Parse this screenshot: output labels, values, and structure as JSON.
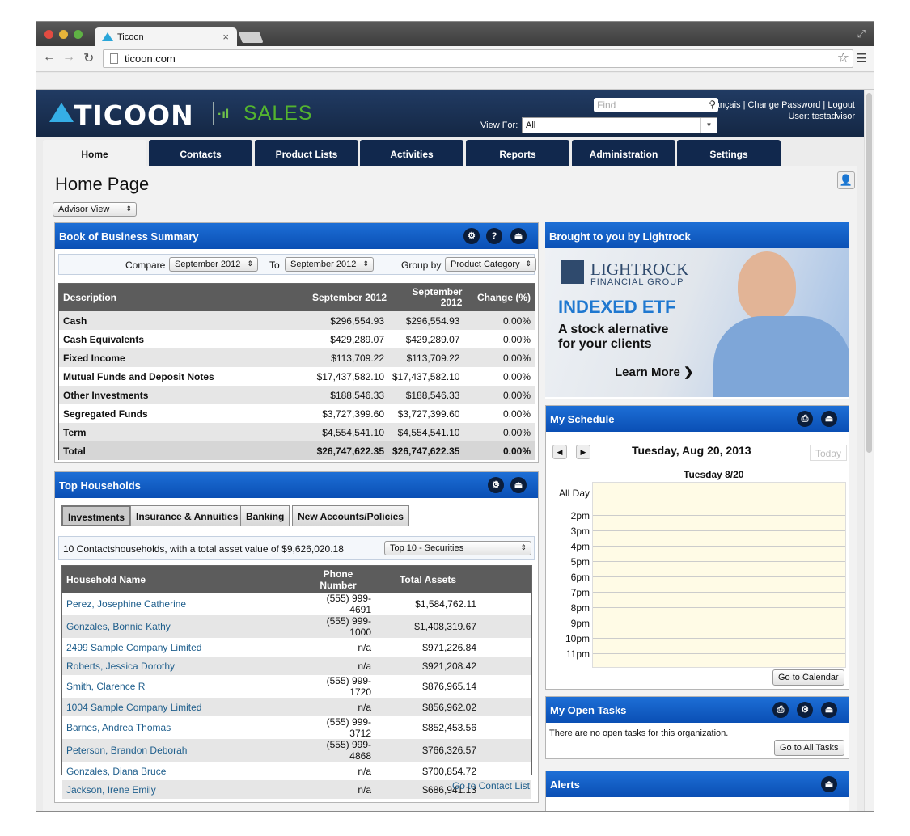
{
  "browser": {
    "tab_title": "Ticoon",
    "url": "ticoon.com"
  },
  "header": {
    "logo_name": "TICOON",
    "logo_sales": "SALES",
    "find_placeholder": "Find",
    "view_for_label": "View For:",
    "view_for_value": "All",
    "links": "Français | Change Password | Logout",
    "user": "User: testadvisor"
  },
  "tabs": [
    {
      "label": "Home"
    },
    {
      "label": "Contacts"
    },
    {
      "label": "Product Lists"
    },
    {
      "label": "Activities"
    },
    {
      "label": "Reports"
    },
    {
      "label": "Administration"
    },
    {
      "label": "Settings"
    }
  ],
  "page": {
    "title": "Home Page",
    "view_select": "Advisor View"
  },
  "book": {
    "title": "Book of Business Summary",
    "compare_label": "Compare",
    "compare_value": "September 2012",
    "to_label": "To",
    "to_value": "September 2012",
    "group_label": "Group by",
    "group_value": "Product Category",
    "columns": [
      "Description",
      "September 2012",
      "September 2012",
      "Change (%)"
    ],
    "rows": [
      [
        "Cash",
        "$296,554.93",
        "$296,554.93",
        "0.00%"
      ],
      [
        "Cash Equivalents",
        "$429,289.07",
        "$429,289.07",
        "0.00%"
      ],
      [
        "Fixed Income",
        "$113,709.22",
        "$113,709.22",
        "0.00%"
      ],
      [
        "Mutual Funds and Deposit Notes",
        "$17,437,582.10",
        "$17,437,582.10",
        "0.00%"
      ],
      [
        "Other Investments",
        "$188,546.33",
        "$188,546.33",
        "0.00%"
      ],
      [
        "Segregated Funds",
        "$3,727,399.60",
        "$3,727,399.60",
        "0.00%"
      ],
      [
        "Term",
        "$4,554,541.10",
        "$4,554,541.10",
        "0.00%"
      ],
      [
        "Total",
        "$26,747,622.35",
        "$26,747,622.35",
        "0.00%"
      ]
    ]
  },
  "households": {
    "title": "Top Households",
    "subtabs": [
      "Investments",
      "Insurance & Annuities",
      "Banking",
      "New Accounts/Policies"
    ],
    "summary": "10 Contactshouseholds, with a total asset value of $9,626,020.18",
    "filter": "Top 10 - Securities",
    "columns": [
      "Household Name",
      "Phone Number",
      "Total Assets"
    ],
    "rows": [
      [
        "Perez, Josephine Catherine",
        "(555) 999-4691",
        "$1,584,762.11"
      ],
      [
        "Gonzales, Bonnie Kathy",
        "(555) 999-1000",
        "$1,408,319.67"
      ],
      [
        "2499 Sample Company Limited",
        "n/a",
        "$971,226.84"
      ],
      [
        "Roberts, Jessica Dorothy",
        "n/a",
        "$921,208.42"
      ],
      [
        "Smith, Clarence R",
        "(555) 999-1720",
        "$876,965.14"
      ],
      [
        "1004 Sample Company Limited",
        "n/a",
        "$856,962.02"
      ],
      [
        "Barnes, Andrea Thomas",
        "(555) 999-3712",
        "$852,453.56"
      ],
      [
        "Peterson, Brandon Deborah",
        "(555) 999-4868",
        "$766,326.57"
      ],
      [
        "Gonzales, Diana Bruce",
        "n/a",
        "$700,854.72"
      ],
      [
        "Jackson, Irene Emily",
        "n/a",
        "$686,941.13"
      ]
    ],
    "footer_link": "Go to Contact List"
  },
  "ad": {
    "title": "Brought to you by Lightrock",
    "brand_line1": "LIGHTROCK",
    "brand_line2": "FINANCIAL GROUP",
    "headline": "INDEXED ETF",
    "tag1": "A stock alernative",
    "tag2": "for your clients",
    "cta": "Learn More"
  },
  "schedule": {
    "title": "My Schedule",
    "date": "Tuesday, Aug 20, 2013",
    "today": "Today",
    "day_header": "Tuesday 8/20",
    "all_day": "All Day",
    "hours": [
      "2pm",
      "3pm",
      "4pm",
      "5pm",
      "6pm",
      "7pm",
      "8pm",
      "9pm",
      "10pm",
      "11pm"
    ],
    "button": "Go to Calendar"
  },
  "tasks": {
    "title": "My Open Tasks",
    "message": "There are no open tasks for this organization.",
    "button": "Go to All Tasks"
  },
  "alerts": {
    "title": "Alerts"
  }
}
